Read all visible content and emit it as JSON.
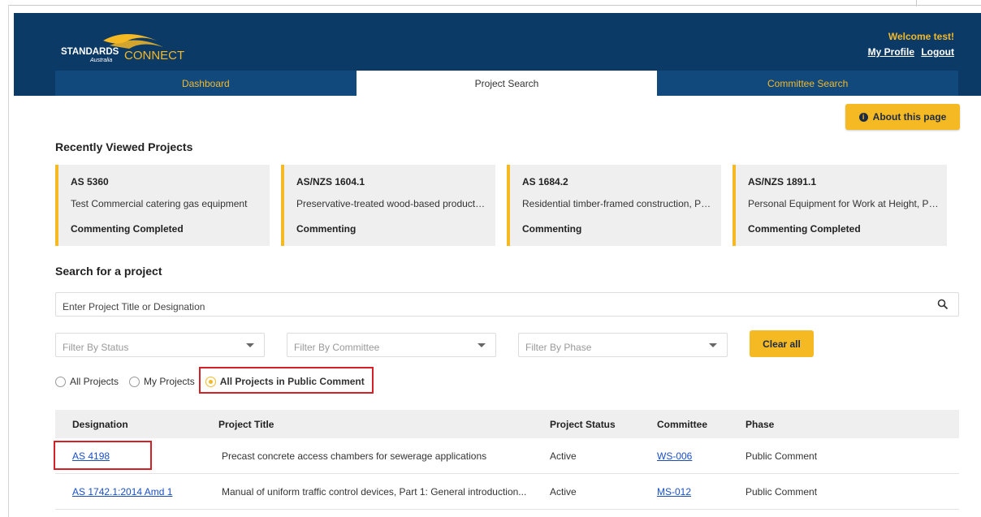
{
  "logo": {
    "word1": "STANDARDS",
    "word2": "Australia",
    "word3": "CONNECT"
  },
  "user": {
    "welcome": "Welcome test!",
    "profile": "My Profile",
    "logout": "Logout"
  },
  "tabs": [
    {
      "label": "Dashboard",
      "active": false
    },
    {
      "label": "Project Search",
      "active": true
    },
    {
      "label": "Committee Search",
      "active": false
    }
  ],
  "about_button": "About this page",
  "recent": {
    "title": "Recently Viewed Projects",
    "cards": [
      {
        "designation": "AS 5360",
        "title": "Test Commercial catering gas equipment",
        "status": "Commenting Completed"
      },
      {
        "designation": "AS/NZS 1604.1",
        "title": "Preservative-treated wood-based products, ...",
        "status": "Commenting"
      },
      {
        "designation": "AS 1684.2",
        "title": "Residential timber-framed construction, Par...",
        "status": "Commenting"
      },
      {
        "designation": "AS/NZS 1891.1",
        "title": "Personal Equipment for Work at Height, Par...",
        "status": "Commenting Completed"
      }
    ]
  },
  "search": {
    "title": "Search for a project",
    "placeholder": "Enter Project Title or Designation",
    "filters": [
      "Filter By Status",
      "Filter By Committee",
      "Filter By Phase"
    ],
    "clear_label": "Clear all"
  },
  "radios": [
    {
      "label": "All Projects",
      "selected": false
    },
    {
      "label": "My Projects",
      "selected": false
    },
    {
      "label": "All Projects in Public Comment",
      "selected": true
    }
  ],
  "table": {
    "headers": [
      "Designation",
      "Project Title",
      "Project Status",
      "Committee",
      "Phase"
    ],
    "rows": [
      {
        "designation": "AS 4198",
        "title": "Precast concrete access chambers for sewerage applications",
        "status": "Active",
        "committee": "WS-006",
        "phase": "Public Comment"
      },
      {
        "designation": "AS 1742.1:2014 Amd 1",
        "title": "Manual of uniform traffic control devices, Part 1: General introduction...",
        "status": "Active",
        "committee": "MS-012",
        "phase": "Public Comment"
      }
    ]
  },
  "colors": {
    "navy": "#0b3a66",
    "gold": "#f5b924",
    "highlight": "#d42027",
    "link": "#1a4fc4"
  }
}
